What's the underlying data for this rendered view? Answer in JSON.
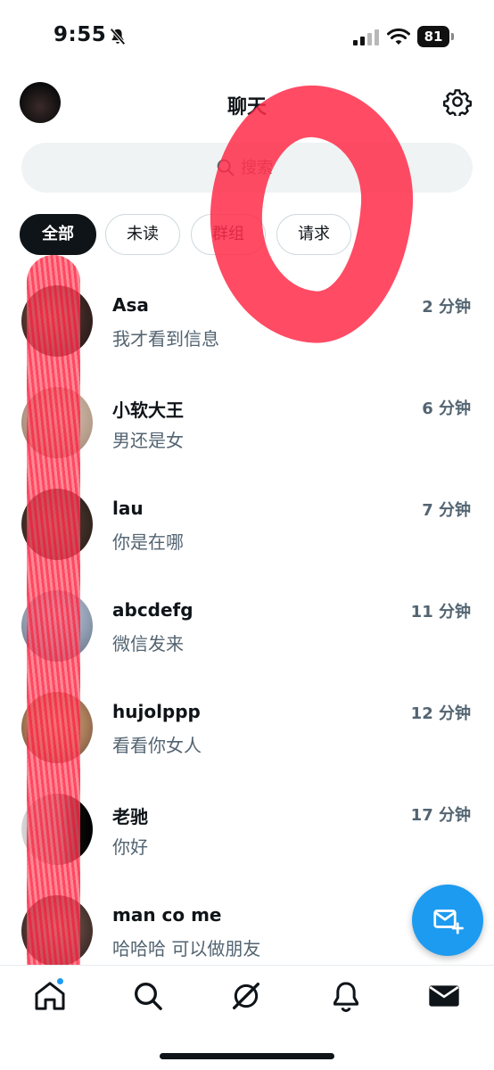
{
  "status_bar": {
    "time": "9:55",
    "battery": "81",
    "icons": [
      "bell-off-icon",
      "cellular-signal-icon",
      "wifi-icon",
      "battery-icon"
    ]
  },
  "header": {
    "title": "聊天",
    "avatar_icon": "user-avatar",
    "settings_icon": "gear-icon"
  },
  "search": {
    "icon": "search-icon",
    "placeholder": "搜索"
  },
  "filters": [
    {
      "label": "全部",
      "active": true
    },
    {
      "label": "未读",
      "active": false
    },
    {
      "label": "群组",
      "active": false
    },
    {
      "label": "请求",
      "active": false
    }
  ],
  "conversations": [
    {
      "name": "Asa",
      "preview": "我才看到信息",
      "time": "2 分钟"
    },
    {
      "name": "小软大王",
      "preview": "男还是女",
      "time": "6 分钟"
    },
    {
      "name": "lau",
      "preview": "你是在哪",
      "time": "7 分钟"
    },
    {
      "name": "abcdefg",
      "preview": "微信发来",
      "time": "11 分钟"
    },
    {
      "name": "hujolppp",
      "preview": "看看你女人",
      "time": "12 分钟"
    },
    {
      "name": "老驰",
      "preview": "你好",
      "time": "17 分钟"
    },
    {
      "name": "man co me",
      "preview": "哈哈哈 可以做朋友",
      "time": ""
    }
  ],
  "compose_icon": "new-message-icon",
  "bottom_nav": [
    "home-icon",
    "search-icon",
    "grok-icon",
    "bell-icon",
    "mail-icon"
  ],
  "colors": {
    "accent": "#1d9bf0",
    "text_primary": "#0f1419",
    "text_secondary": "#536471",
    "scribble": "#ff2d4b"
  }
}
